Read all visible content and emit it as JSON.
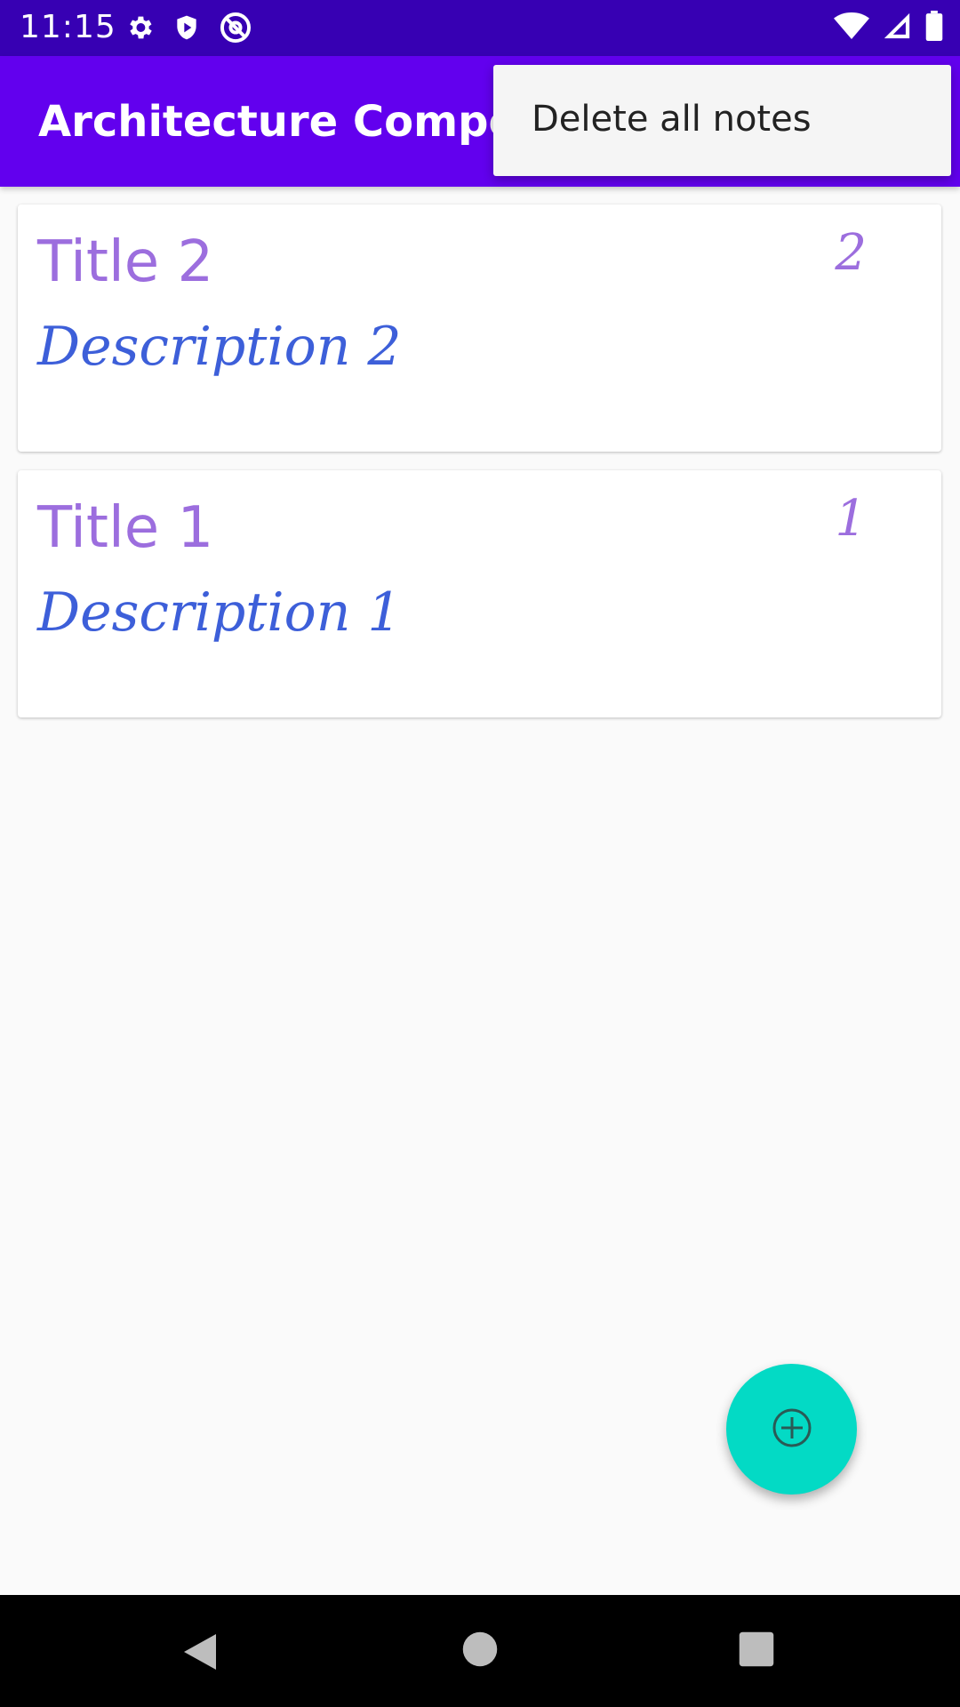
{
  "status_bar": {
    "time": "11:15",
    "icons_left": [
      "gear-icon",
      "shield-icon",
      "at-sign-icon"
    ],
    "icons_right": [
      "wifi-icon",
      "cellular-signal-icon",
      "battery-icon"
    ],
    "background": "#3700b3"
  },
  "app_bar": {
    "title": "Architecture Components",
    "background": "#6200ee"
  },
  "menu": {
    "items": [
      {
        "label": "Delete all notes"
      }
    ]
  },
  "notes": [
    {
      "title": "Title 2",
      "description": "Description 2",
      "priority": "2"
    },
    {
      "title": "Title 1",
      "description": "Description 1",
      "priority": "1"
    }
  ],
  "fab": {
    "icon": "add-circle-icon",
    "background": "#03dac5"
  },
  "nav_bar": {
    "buttons": [
      "back-icon",
      "home-icon",
      "recents-icon"
    ]
  },
  "colors": {
    "title": "#9c6ede",
    "description": "#3d5fd9"
  }
}
